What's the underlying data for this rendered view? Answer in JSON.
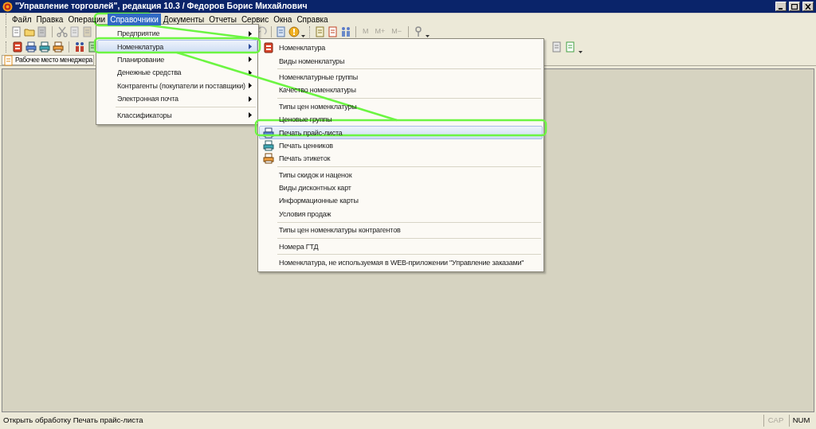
{
  "window": {
    "title": "\"Управление торговлей\", редакция 10.3 / Федоров Борис Михайлович"
  },
  "menu_bar": [
    {
      "label": "Файл",
      "selected": false
    },
    {
      "label": "Правка",
      "selected": false
    },
    {
      "label": "Операции",
      "selected": false
    },
    {
      "label": "Справочники",
      "selected": true
    },
    {
      "label": "Документы",
      "selected": false
    },
    {
      "label": "Отчеты",
      "selected": false
    },
    {
      "label": "Сервис",
      "selected": false
    },
    {
      "label": "Окна",
      "selected": false
    },
    {
      "label": "Справка",
      "selected": false
    }
  ],
  "toolbar": {
    "memory_buttons": [
      "M",
      "M+",
      "M−"
    ]
  },
  "panel_tab": {
    "label": "Рабочее место менеджера"
  },
  "dropdown_menu": {
    "groups": [
      [
        {
          "label": "Предприятие",
          "selected": false
        },
        {
          "label": "Номенклатура",
          "selected": true
        },
        {
          "label": "Планирование",
          "selected": false
        },
        {
          "label": "Денежные средства",
          "selected": false
        },
        {
          "label": "Контрагенты (покупатели и поставщики)",
          "selected": false
        },
        {
          "label": "Электронная почта",
          "selected": false
        }
      ],
      [
        {
          "label": "Классификаторы",
          "selected": false
        }
      ]
    ]
  },
  "submenu": {
    "groups": [
      [
        {
          "label": "Номенклатура",
          "selected": false
        },
        {
          "label": "Виды номенклатуры",
          "selected": false
        }
      ],
      [
        {
          "label": "Номенклатурные группы",
          "selected": false
        },
        {
          "label": "Качество номенклатуры",
          "selected": false
        }
      ],
      [
        {
          "label": "Типы цен номенклатуры",
          "selected": false
        },
        {
          "label": "Ценовые группы",
          "selected": false
        },
        {
          "label": "Печать прайс-листа",
          "selected": true
        },
        {
          "label": "Печать ценников",
          "selected": false
        },
        {
          "label": "Печать этикеток",
          "selected": false
        }
      ],
      [
        {
          "label": "Типы скидок и наценок",
          "selected": false
        },
        {
          "label": "Виды дисконтных карт",
          "selected": false
        },
        {
          "label": "Информационные карты",
          "selected": false
        },
        {
          "label": "Условия продаж",
          "selected": false
        }
      ],
      [
        {
          "label": "Типы цен номенклатуры контрагентов",
          "selected": false
        }
      ],
      [
        {
          "label": "Номера ГТД",
          "selected": false
        }
      ],
      [
        {
          "label": "Номенклатура, не используемая в WEB-приложении \"Управление заказами\"",
          "selected": false
        }
      ]
    ]
  },
  "status_bar": {
    "message": "Открыть обработку Печать прайс-листа",
    "indicators": [
      {
        "label": "CAP",
        "on": false
      },
      {
        "label": "NUM",
        "on": true
      }
    ]
  }
}
